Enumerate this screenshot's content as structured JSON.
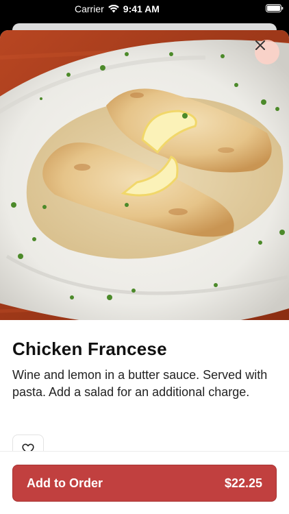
{
  "status_bar": {
    "carrier": "Carrier",
    "time": "9:41 AM"
  },
  "item": {
    "title": "Chicken Francese",
    "description": "Wine and lemon in a butter sauce. Served with pasta. Add a salad for an additional charge."
  },
  "order": {
    "button_label": "Add to Order",
    "price": "$22.25"
  },
  "icons": {
    "close": "close-icon",
    "favorite": "heart-icon",
    "wifi": "wifi-icon",
    "battery": "battery-icon"
  },
  "colors": {
    "accent": "#c1403f",
    "close_button_bg": "#f3c9bf"
  }
}
